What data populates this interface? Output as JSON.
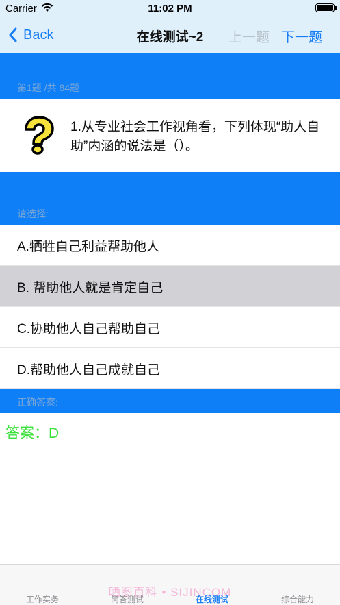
{
  "status": {
    "carrier": "Carrier",
    "time": "11:02 PM"
  },
  "nav": {
    "back_label": "Back",
    "title": "在线测试~2",
    "prev_label": "上一题",
    "next_label": "下一题"
  },
  "question": {
    "progress": "第1题 /共 84题",
    "text": "1.从专业社会工作视角看，下列体现“助人自助”内涵的说法是（）。",
    "icon": "question-mark-icon"
  },
  "options_header": "请选择:",
  "options": [
    {
      "label": "A.牺牲自己利益帮助他人",
      "selected": false
    },
    {
      "label": "B. 帮助他人就是肯定自己",
      "selected": true
    },
    {
      "label": "C.协助他人自己帮助自己",
      "selected": false
    },
    {
      "label": "D.帮助他人自己成就自己",
      "selected": false
    }
  ],
  "answer_header": "正确答案:",
  "answer": "答案：D",
  "watermark": "晒图百科 • SIJINCOM",
  "tabs": [
    {
      "label": "工作实务",
      "active": false
    },
    {
      "label": "简答测试",
      "active": false
    },
    {
      "label": "在线测试",
      "active": true
    },
    {
      "label": "综合能力",
      "active": false
    }
  ],
  "colors": {
    "accent": "#1a7ef5",
    "section_blue": "#0f7ff7",
    "answer_green": "#3ae03a",
    "nav_bg": "#dff0fb"
  }
}
